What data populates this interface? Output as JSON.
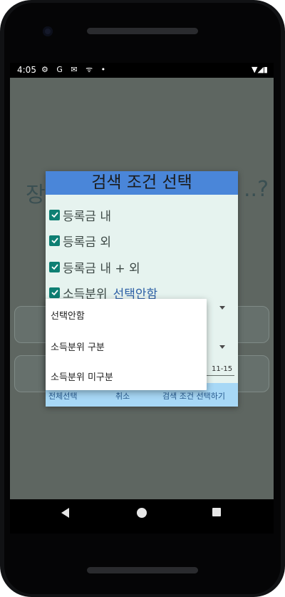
{
  "statusbar": {
    "time": "4:05",
    "left_icons": "⚙ G ✉ ᯤ •",
    "right_icons": "▼◢▮"
  },
  "background": {
    "title_left": "장",
    "title_right": "..?"
  },
  "dialog": {
    "title": "검색 조건 선택",
    "checkboxes": [
      {
        "label": "등록금 내",
        "checked": true
      },
      {
        "label": "등록금 외",
        "checked": true
      },
      {
        "label": "등록금 내 + 외",
        "checked": true
      },
      {
        "label": "소득분위",
        "checked": true,
        "value": "선택안함"
      }
    ],
    "date_fragment": "11-15",
    "actions": {
      "select_all": "전체선택",
      "cancel": "취소",
      "apply": "검색 조건 선택하기"
    }
  },
  "dropdown": {
    "options": [
      "선택안함",
      "소득분위 구분",
      "소득분위 미구분"
    ]
  },
  "colors": {
    "dialog_header": "#4a86d9",
    "checkbox": "#0e7f73",
    "dialog_body": "#e6f3ef",
    "actions_bar": "#a7d8f6"
  }
}
